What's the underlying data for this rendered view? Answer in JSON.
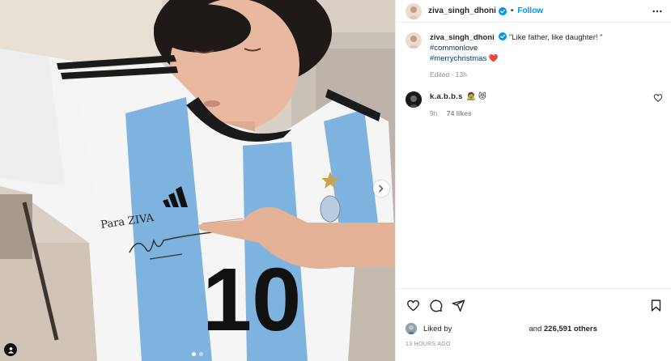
{
  "post": {
    "author": {
      "username": "ziva_singh_dhoni",
      "verified": true,
      "follow_label": "Follow",
      "separator": "•"
    },
    "caption": {
      "username": "ziva_singh_dhoni",
      "text": "\"Like father, like daughter! \" ",
      "hashtag_1": "#commonlove",
      "hashtag_2": "#merrychristmas",
      "heart": "❤️",
      "meta": "Edited · 13h"
    },
    "comments": [
      {
        "username": "k.a.b.b.s",
        "emojis": "🧟 😻",
        "time": "9h",
        "likes": "74 likes"
      }
    ],
    "likes": {
      "liked_by_label": "Liked by",
      "and_label": "and",
      "count": "226,591",
      "others_label": "others"
    },
    "timestamp": "13 HOURS AGO",
    "carousel": {
      "slides": 2,
      "active_index": 0
    }
  },
  "photo": {
    "jersey_text": "Para ZIVA",
    "jersey_number": "10"
  },
  "icons": [
    "more-options-icon",
    "verified-badge-icon",
    "heart-icon",
    "comment-icon",
    "share-icon",
    "bookmark-icon",
    "chevron-right-icon",
    "tagged-user-icon"
  ],
  "colors": {
    "accent": "#0095f6",
    "hashtag": "#00376b",
    "text": "#262626",
    "muted": "#8e8e8e",
    "jersey_blue": "#7fb3df"
  }
}
